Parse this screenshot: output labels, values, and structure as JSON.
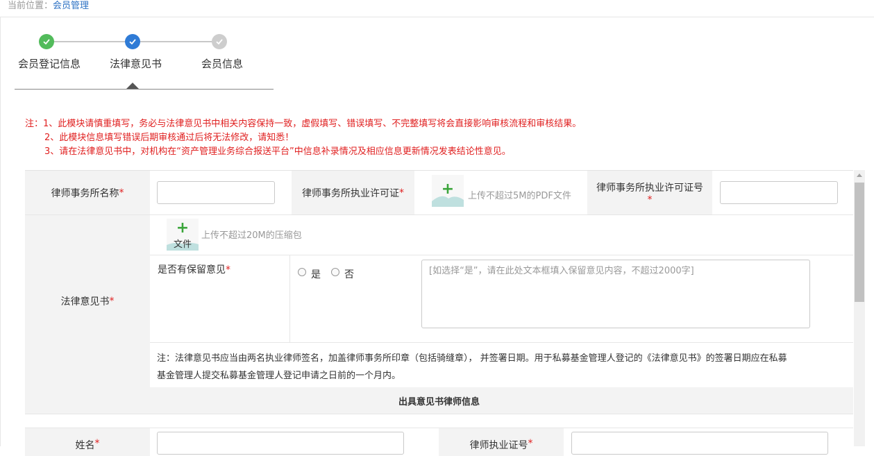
{
  "breadcrumb": {
    "prefix": "当前位置：",
    "current": "会员管理"
  },
  "steps": [
    {
      "label": "会员登记信息",
      "status": "done"
    },
    {
      "label": "法律意见书",
      "status": "current"
    },
    {
      "label": "会员信息",
      "status": "todo"
    }
  ],
  "notes": [
    "注：1、此模块请慎重填写，务必与法律意见书中相关内容保持一致，虚假填写、错误填写、不完整填写将会直接影响审核流程和审核结果。",
    "2、此模块信息填写错误后期审核通过后将无法修改，请知悉！",
    "3、请在法律意见书中，对机构在“资产管理业务综合报送平台”中信息补录情况及相应信息更新情况发表结论性意见。"
  ],
  "form": {
    "required_mark": "*",
    "firm_name_label": "律师事务所名称",
    "firm_license_label": "律师事务所执业许可证",
    "firm_license_upload_text": "文件",
    "firm_license_hint": "上传不超过5M的PDF文件",
    "firm_license_no_label": "律师事务所执业许可证号",
    "legal_opinion_label": "法律意见书",
    "opinion_upload_text": "文件",
    "opinion_upload_hint": "上传不超过20M的压缩包",
    "reservation_label": "是否有保留意见",
    "radio_yes": "是",
    "radio_no": "否",
    "reservation_placeholder": "[如选择“是”，请在此处文本框填入保留意见内容，不超过2000字]",
    "opinion_note_line1": "注：法律意见书应当由两名执业律师签名，加盖律师事务所印章（包括骑缝章），  并签署日期。用于私募基金管理人登记的《法律意见书》的签署日期应在私募",
    "opinion_note_line2": "基金管理人提交私募基金管理人登记申请之日前的一个月内。",
    "lawyer_section_title": "出具意见书律师信息",
    "name_label": "姓名",
    "lawyer_license_label": "律师执业证号"
  },
  "colors": {
    "step_done": "#52bb5b",
    "step_current": "#2f7bd6",
    "step_todo": "#cdcdcd",
    "note_red": "#e02020",
    "link_blue": "#2d72c4",
    "label_bg": "#f3f3f3"
  },
  "icons": [
    "check-icon",
    "plus-icon",
    "mountain-placeholder-icon",
    "scroll-up-arrow-icon"
  ]
}
